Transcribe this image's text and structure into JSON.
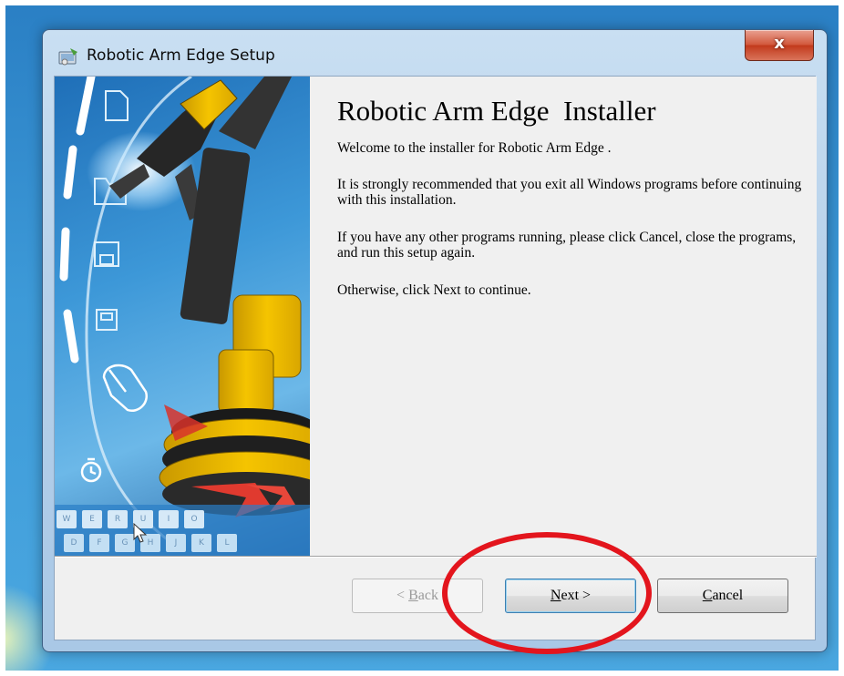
{
  "window": {
    "title": "Robotic Arm Edge Setup",
    "close_label": "x"
  },
  "installer": {
    "heading": "Robotic Arm Edge  Installer",
    "welcome": "Welcome to the installer for Robotic Arm Edge .",
    "recommend": "It is strongly recommended that you exit all Windows programs before continuing with this installation.",
    "other_programs": "If you have any other programs running, please click Cancel, close the programs, and run this setup again.",
    "otherwise": "Otherwise, click Next to continue."
  },
  "side_image": {
    "keys_row1": [
      "W",
      "E",
      "R",
      "U",
      "I",
      "O"
    ],
    "keys_row2": [
      "D",
      "F",
      "G",
      "H",
      "J",
      "K",
      "L"
    ],
    "icons": [
      "document-icon",
      "folder-icon",
      "save-icon",
      "floppy-icon",
      "mouse-icon",
      "timer-icon"
    ]
  },
  "buttons": {
    "back": {
      "prefix": "< ",
      "mnemonic": "B",
      "rest": "ack",
      "enabled": false
    },
    "next": {
      "prefix": "",
      "mnemonic": "N",
      "rest": "ext >",
      "enabled": true
    },
    "cancel": {
      "prefix": "",
      "mnemonic": "C",
      "rest": "ancel",
      "enabled": true
    }
  },
  "colors": {
    "annotation_circle": "#e3151d",
    "robot_yellow": "#f5c400",
    "panel_bg": "#f0f0f0"
  }
}
